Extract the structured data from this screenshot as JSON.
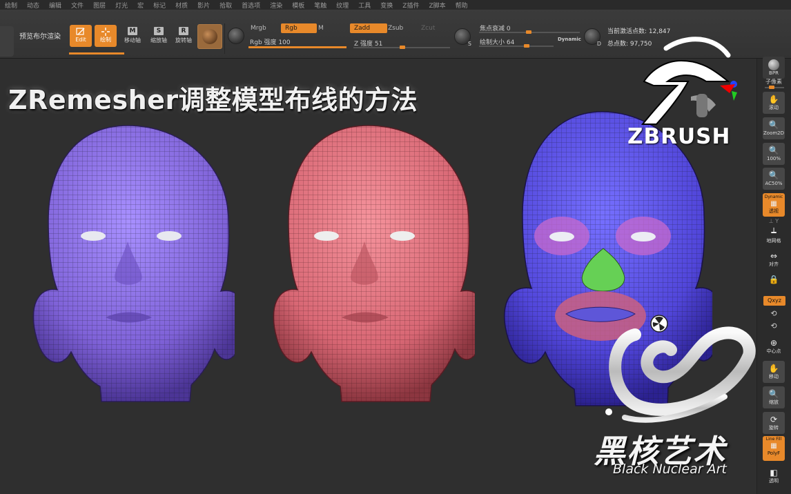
{
  "menu": [
    "绘制",
    "动态",
    "编辑",
    "文件",
    "图层",
    "灯光",
    "宏",
    "标记",
    "材质",
    "影片",
    "拾取",
    "首选项",
    "渲染",
    "模板",
    "笔触",
    "纹理",
    "工具",
    "变换",
    "Z插件",
    "Z脚本",
    "帮助"
  ],
  "toolbar": {
    "preview_label": "预览布尔渲染",
    "edit_label": "Edit",
    "draw_label": "绘制",
    "move_label": "移动轴",
    "scale_label": "缩放轴",
    "rotate_label": "旋转轴",
    "move_key": "M",
    "scale_key": "S",
    "rotate_key": "R",
    "mrgb": "Mrgb",
    "rgb": "Rgb",
    "m": "M",
    "rgb_intensity": "Rgb 强度 100",
    "zadd": "Zadd",
    "zsub": "Zsub",
    "zcut": "Zcut",
    "z_intensity": "Z 强度 51",
    "focal_shift": "焦点衰减 0",
    "draw_size": "绘制大小 64",
    "dynamic": "Dynamic",
    "s_key": "S",
    "d_key": "D",
    "active_points": "当前激活点数: 12,847",
    "total_points": "总点数: 97,750",
    "rgb_intensity_value": 100,
    "z_intensity_value": 51,
    "draw_size_value": 64
  },
  "canvas": {
    "title": "ZRemesher调整模型布线的方法",
    "heads": [
      {
        "name": "purple",
        "color": "#8f72e6"
      },
      {
        "name": "pink",
        "color": "#e2727f"
      },
      {
        "name": "blue",
        "color": "#5d53e0"
      }
    ],
    "zbrush_brand": "ZBRUSH",
    "studio_cn": "黑核艺术",
    "studio_en": "Black Nuclear Art"
  },
  "tray": {
    "bpr": "BPR",
    "subpixel": "子像素",
    "scroll": "滚动",
    "zoom2d": "Zoom2D",
    "p100": "100%",
    "ac50": "AC50%",
    "dynamic_label": "Dynamic",
    "persp": "透视",
    "floor": "地网格",
    "align": "对齐",
    "xyz": "Qxyz",
    "center": "中心点",
    "move": "移动",
    "scale": "缩放",
    "rotate": "旋转",
    "linefill": "Line Fill",
    "polyf": "PolyF",
    "transp": "透明"
  },
  "colors": {
    "accent": "#e8892a",
    "bg": "#2f2f2f"
  }
}
